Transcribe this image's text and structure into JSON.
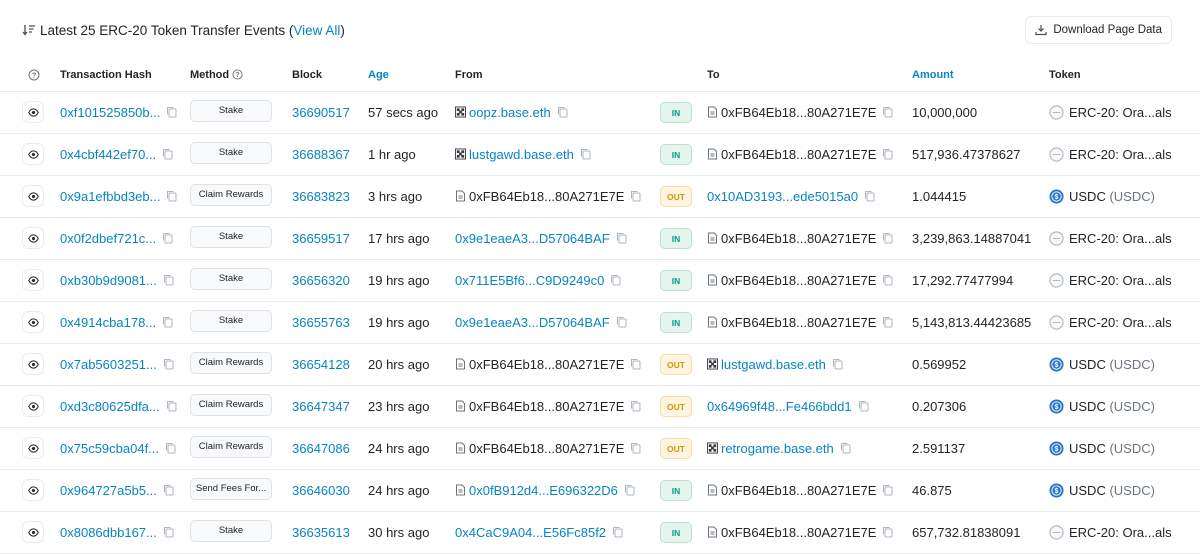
{
  "header": {
    "title_prefix": "Latest 25 ERC-20 Token Transfer Events (",
    "view_all": "View All",
    "title_suffix": ")",
    "download_label": "Download Page Data"
  },
  "columns": {
    "tx_hash": "Transaction Hash",
    "method": "Method",
    "block": "Block",
    "age": "Age",
    "from": "From",
    "to": "To",
    "amount": "Amount",
    "token": "Token"
  },
  "icons": {
    "eye": "eye-icon",
    "copy": "copy-icon",
    "contract": "document-icon",
    "ens": "ens-avatar-icon",
    "usdc": "usdc-icon",
    "generic_token": "token-icon"
  },
  "colors": {
    "link": "#0784c3",
    "in_badge": "#00a186",
    "out_badge": "#cc9a06",
    "usdc": "#2775ca"
  },
  "rows": [
    {
      "hash": "0xf101525850b...",
      "method": "Stake",
      "block": "36690517",
      "age": "57 secs ago",
      "from": "oopz.base.eth",
      "from_type": "ens",
      "from_link": true,
      "dir": "IN",
      "to": "0xFB64Eb18...80A271E7E",
      "to_type": "contract",
      "to_link": false,
      "amount": "10,000,000",
      "token": "ERC-20: Ora...als",
      "token_sym": "",
      "token_type": "generic"
    },
    {
      "hash": "0x4cbf442ef70...",
      "method": "Stake",
      "block": "36688367",
      "age": "1 hr ago",
      "from": "lustgawd.base.eth",
      "from_type": "ens",
      "from_link": true,
      "dir": "IN",
      "to": "0xFB64Eb18...80A271E7E",
      "to_type": "contract",
      "to_link": false,
      "amount": "517,936.47378627",
      "token": "ERC-20: Ora...als",
      "token_sym": "",
      "token_type": "generic"
    },
    {
      "hash": "0x9a1efbbd3eb...",
      "method": "Claim Rewards",
      "block": "36683823",
      "age": "3 hrs ago",
      "from": "0xFB64Eb18...80A271E7E",
      "from_type": "contract",
      "from_link": false,
      "dir": "OUT",
      "to": "0x10AD3193...ede5015a0",
      "to_type": "none",
      "to_link": true,
      "amount": "1.044415",
      "token": "USDC",
      "token_sym": "(USDC)",
      "token_type": "usdc"
    },
    {
      "hash": "0x0f2dbef721c...",
      "method": "Stake",
      "block": "36659517",
      "age": "17 hrs ago",
      "from": "0x9e1eaeA3...D57064BAF",
      "from_type": "none",
      "from_link": true,
      "dir": "IN",
      "to": "0xFB64Eb18...80A271E7E",
      "to_type": "contract",
      "to_link": false,
      "amount": "3,239,863.14887041",
      "token": "ERC-20: Ora...als",
      "token_sym": "",
      "token_type": "generic"
    },
    {
      "hash": "0xb30b9d9081...",
      "method": "Stake",
      "block": "36656320",
      "age": "19 hrs ago",
      "from": "0x711E5Bf6...C9D9249c0",
      "from_type": "none",
      "from_link": true,
      "dir": "IN",
      "to": "0xFB64Eb18...80A271E7E",
      "to_type": "contract",
      "to_link": false,
      "amount": "17,292.77477994",
      "token": "ERC-20: Ora...als",
      "token_sym": "",
      "token_type": "generic"
    },
    {
      "hash": "0x4914cba178...",
      "method": "Stake",
      "block": "36655763",
      "age": "19 hrs ago",
      "from": "0x9e1eaeA3...D57064BAF",
      "from_type": "none",
      "from_link": true,
      "dir": "IN",
      "to": "0xFB64Eb18...80A271E7E",
      "to_type": "contract",
      "to_link": false,
      "amount": "5,143,813.44423685",
      "token": "ERC-20: Ora...als",
      "token_sym": "",
      "token_type": "generic"
    },
    {
      "hash": "0x7ab5603251...",
      "method": "Claim Rewards",
      "block": "36654128",
      "age": "20 hrs ago",
      "from": "0xFB64Eb18...80A271E7E",
      "from_type": "contract",
      "from_link": false,
      "dir": "OUT",
      "to": "lustgawd.base.eth",
      "to_type": "ens",
      "to_link": true,
      "amount": "0.569952",
      "token": "USDC",
      "token_sym": "(USDC)",
      "token_type": "usdc"
    },
    {
      "hash": "0xd3c80625dfa...",
      "method": "Claim Rewards",
      "block": "36647347",
      "age": "23 hrs ago",
      "from": "0xFB64Eb18...80A271E7E",
      "from_type": "contract",
      "from_link": false,
      "dir": "OUT",
      "to": "0x64969f48...Fe466bdd1",
      "to_type": "none",
      "to_link": true,
      "amount": "0.207306",
      "token": "USDC",
      "token_sym": "(USDC)",
      "token_type": "usdc"
    },
    {
      "hash": "0x75c59cba04f...",
      "method": "Claim Rewards",
      "block": "36647086",
      "age": "24 hrs ago",
      "from": "0xFB64Eb18...80A271E7E",
      "from_type": "contract",
      "from_link": false,
      "dir": "OUT",
      "to": "retrogame.base.eth",
      "to_type": "ens",
      "to_link": true,
      "amount": "2.591137",
      "token": "USDC",
      "token_sym": "(USDC)",
      "token_type": "usdc"
    },
    {
      "hash": "0x964727a5b5...",
      "method": "Send Fees For...",
      "block": "36646030",
      "age": "24 hrs ago",
      "from": "0x0fB912d4...E696322D6",
      "from_type": "contract",
      "from_link": true,
      "dir": "IN",
      "to": "0xFB64Eb18...80A271E7E",
      "to_type": "contract",
      "to_link": false,
      "amount": "46.875",
      "token": "USDC",
      "token_sym": "(USDC)",
      "token_type": "usdc"
    },
    {
      "hash": "0x8086dbb167...",
      "method": "Stake",
      "block": "36635613",
      "age": "30 hrs ago",
      "from": "0x4CaC9A04...E56Fc85f2",
      "from_type": "none",
      "from_link": true,
      "dir": "IN",
      "to": "0xFB64Eb18...80A271E7E",
      "to_type": "contract",
      "to_link": false,
      "amount": "657,732.81838091",
      "token": "ERC-20: Ora...als",
      "token_sym": "",
      "token_type": "generic"
    }
  ]
}
